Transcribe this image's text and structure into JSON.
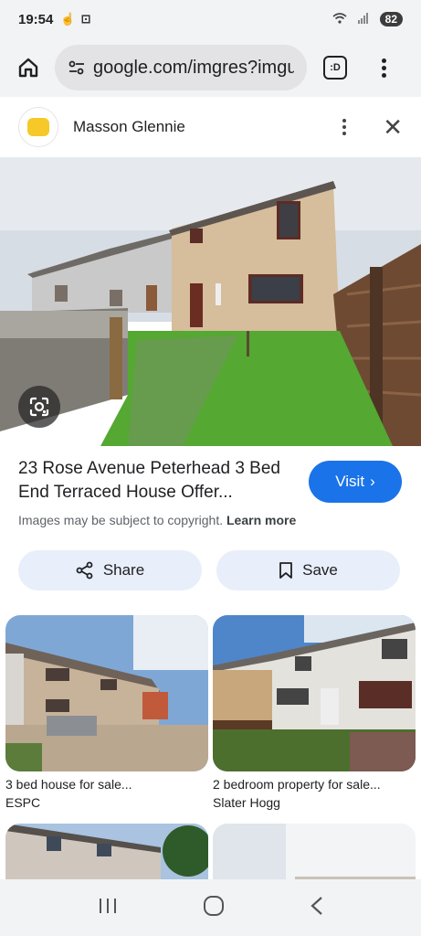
{
  "status_bar": {
    "time": "19:54",
    "battery": "82"
  },
  "browser": {
    "url": "google.com/imgres?imgu",
    "tab_label": ":D"
  },
  "source": {
    "name": "Masson Glennie"
  },
  "result": {
    "title": "23 Rose Avenue Peterhead 3 Bed End Terraced House Offer...",
    "copyright_text": "Images may be subject to copyright.",
    "learn_more": "Learn more",
    "visit_label": "Visit"
  },
  "actions": {
    "share_label": "Share",
    "save_label": "Save"
  },
  "related": [
    {
      "title": "3 bed house for sale...",
      "source": "ESPC"
    },
    {
      "title": "2 bedroom property for sale...",
      "source": "Slater Hogg"
    },
    {
      "title": "",
      "source": ""
    },
    {
      "title": "",
      "source": ""
    }
  ],
  "colors": {
    "accent": "#1a73e8",
    "chip_bg": "#e8eefa",
    "chrome_bg": "#f1f3f4"
  }
}
